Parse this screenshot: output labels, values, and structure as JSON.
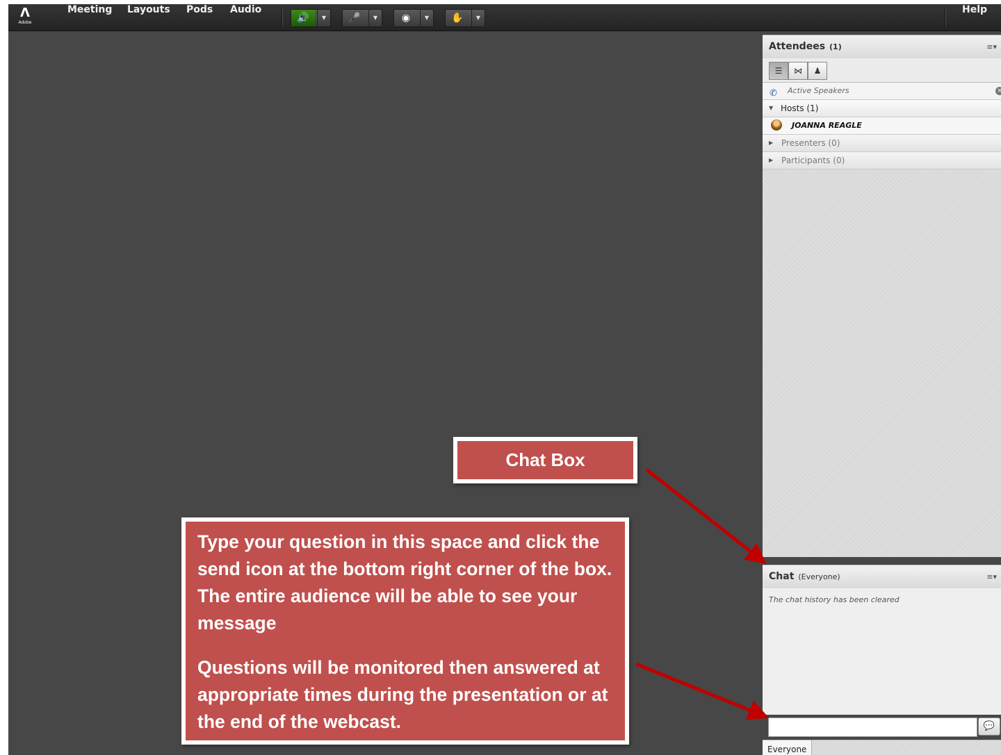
{
  "menubar": {
    "logo_text": "Adobe",
    "items": [
      "Meeting",
      "Layouts",
      "Pods",
      "Audio"
    ],
    "help": "Help"
  },
  "attendees": {
    "title": "Attendees",
    "count": "(1)",
    "active_speakers": "Active Speakers",
    "hosts": "Hosts (1)",
    "host_name": "JOANNA REAGLE",
    "presenters": "Presenters (0)",
    "participants": "Participants (0)"
  },
  "chat": {
    "title": "Chat",
    "scope": "(Everyone)",
    "history": "The chat history has been cleared",
    "input_value": "",
    "footer_tab": "Everyone"
  },
  "callouts": {
    "chat_box": "Chat Box",
    "paragraph1": "Type your question in this space and click the send icon at the bottom right corner of the box. The entire audience will be able to see your message",
    "paragraph2": "Questions will be monitored then answered at appropriate times during the presentation or at the end of the webcast."
  },
  "colors": {
    "stage": "#474747",
    "callout_fill": "#c0504d",
    "arrow": "#c00000",
    "speaker_on": "#9dff4c"
  },
  "icons": [
    "adobe-logo",
    "speaker-icon",
    "microphone-icon",
    "webcam-icon",
    "raise-hand-icon",
    "pod-menu-icon",
    "list-view-icon",
    "grid-view-icon",
    "attendee-status-icon",
    "phone-icon",
    "host-icon",
    "send-message-icon"
  ]
}
